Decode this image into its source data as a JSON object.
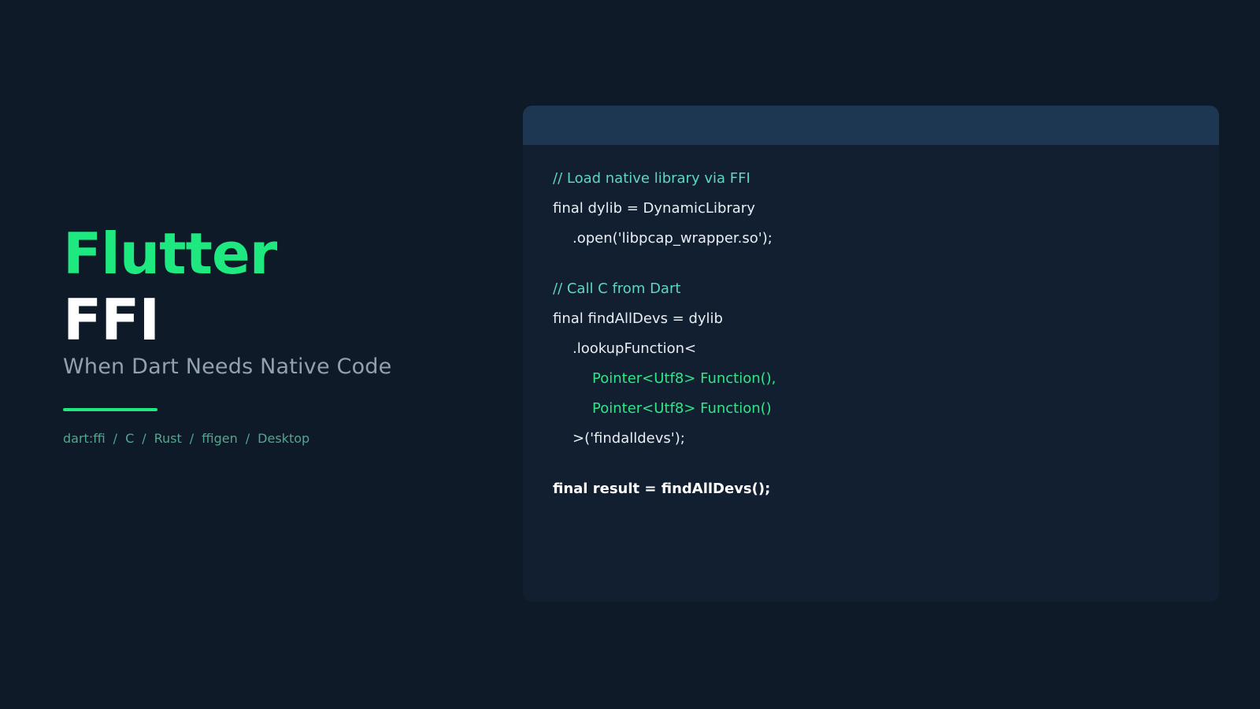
{
  "colors": {
    "background": "#0e1a27",
    "accent": "#1ee880",
    "panel": "#111f30",
    "panel_header": "#1d3652",
    "comment": "#5fd6c5",
    "tag": "#4fa890"
  },
  "hero": {
    "title_line1": "Flutter",
    "title_line2": "FFI",
    "subtitle": "When Dart Needs Native Code"
  },
  "tags": [
    "dart:ffi",
    "C",
    "Rust",
    "ffigen",
    "Desktop"
  ],
  "tag_separator": "/",
  "code": {
    "lines": [
      "// Load native library via FFI",
      "final dylib = DynamicLibrary",
      ".open('libpcap_wrapper.so');",
      "// Call C from Dart",
      "final findAllDevs = dylib",
      ".lookupFunction<",
      "Pointer<Utf8> Function(),",
      "Pointer<Utf8> Function()",
      ">('findalldevs');",
      "final result = findAllDevs();"
    ]
  }
}
